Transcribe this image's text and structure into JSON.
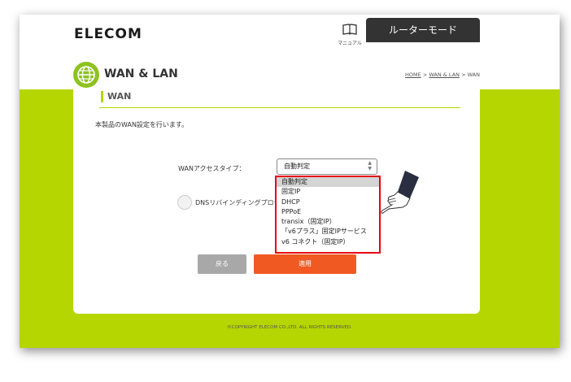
{
  "header": {
    "logo": "ELECOM",
    "manual_label": "マニュアル",
    "mode_tab": "ルーターモード"
  },
  "page": {
    "title": "WAN & LAN",
    "breadcrumb": {
      "home": "HOME",
      "sep1": " > ",
      "wanlan": "WAN & LAN",
      "sep2": " > ",
      "current": "WAN"
    }
  },
  "section": {
    "title": "WAN",
    "description": "本製品のWAN設定を行います。"
  },
  "form": {
    "wan_access_label": "WANアクセスタイプ：",
    "wan_access_value": "自動判定",
    "options": [
      "自動判定",
      "固定IP",
      "DHCP",
      "PPPoE",
      "transix（固定IP）",
      "「v6プラス」固定IPサービス",
      "v6 コネクト（固定IP）"
    ],
    "dns_label": "DNSリバインディングプロテクション"
  },
  "buttons": {
    "back": "戻る",
    "apply": "適用"
  },
  "footer": {
    "copyright": "©COPYRIGHT ELECOM CO.,LTD. ALL RIGHTS RESERVED."
  },
  "colors": {
    "accent_green": "#b5d600",
    "apply_orange": "#f05a22",
    "highlight_red": "#e60012",
    "tab_dark": "#333333"
  },
  "icons": [
    "manual-book-icon",
    "globe-icon",
    "select-arrows-icon",
    "pointing-hand-icon"
  ]
}
